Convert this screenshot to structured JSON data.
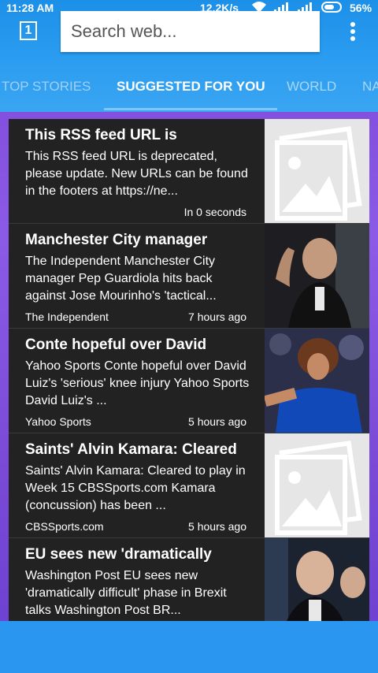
{
  "status": {
    "time": "11:28 AM",
    "network": "12.2K/s",
    "battery": "56%"
  },
  "toolbar": {
    "tab_count": "1",
    "search_placeholder": "Search web..."
  },
  "tabs": [
    {
      "label": "TOP STORIES"
    },
    {
      "label": "SUGGESTED FOR YOU"
    },
    {
      "label": "WORLD"
    },
    {
      "label": "NA"
    }
  ],
  "feed": [
    {
      "title": "This RSS feed URL is",
      "desc": "This RSS feed URL is deprecated, please update. New URLs can be found in the footers at https://ne...",
      "source": "",
      "time": "In 0 seconds"
    },
    {
      "title": "Manchester City manager",
      "desc": "The Independent Manchester City manager Pep Guardiola hits back against Jose Mourinho's 'tactical...",
      "source": "The Independent",
      "time": "7 hours ago"
    },
    {
      "title": "Conte hopeful over David",
      "desc": "Yahoo Sports Conte hopeful over David Luiz's 'serious' knee injury Yahoo Sports David Luiz's ...",
      "source": "Yahoo Sports",
      "time": "5 hours ago"
    },
    {
      "title": "Saints' Alvin Kamara: Cleared",
      "desc": "Saints' Alvin Kamara: Cleared to play in Week 15 CBSSports.com Kamara (concussion) has been ...",
      "source": "CBSSports.com",
      "time": "5 hours ago"
    },
    {
      "title": "EU sees new 'dramatically",
      "desc": "Washington Post EU sees new 'dramatically difficult' phase in Brexit talks Washington Post BR...",
      "source": "",
      "time": ""
    }
  ],
  "colors": {
    "header": "#2a9cf0",
    "accent": "#7fc6ff",
    "card": "#222222",
    "background": "#7c46d8"
  }
}
